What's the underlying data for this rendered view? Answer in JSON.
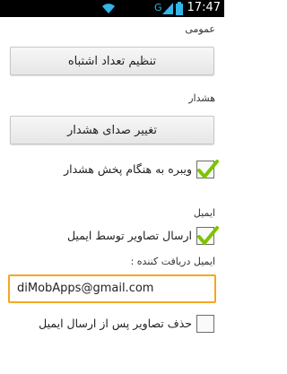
{
  "status_bar": {
    "time": "17:47",
    "network_label": "G",
    "icons": [
      "wifi-icon",
      "network-signal-icon",
      "battery-icon"
    ]
  },
  "sections": {
    "general": "عمومی",
    "alarm": "هشدار",
    "email": "ایمیل"
  },
  "buttons": {
    "sensitivity": "تنظیم تعداد اشتباه",
    "alarm_sound": "تغییر صدای هشدار"
  },
  "checkboxes": {
    "vibrate": {
      "label": "ویبره به هنگام پخش هشدار",
      "checked": true
    },
    "send_email": {
      "label": "ارسال تصاویر توسط ایمیل",
      "checked": true
    },
    "delete_after_send": {
      "label": "حذف تصاویر پس از ارسال ایمیل",
      "checked": false
    }
  },
  "recipient": {
    "label": "ایمیل دریافت کننده :",
    "value": "diMobApps@gmail.com"
  },
  "colors": {
    "accent_focus": "#f5a623",
    "check_green": "#7dc400"
  }
}
